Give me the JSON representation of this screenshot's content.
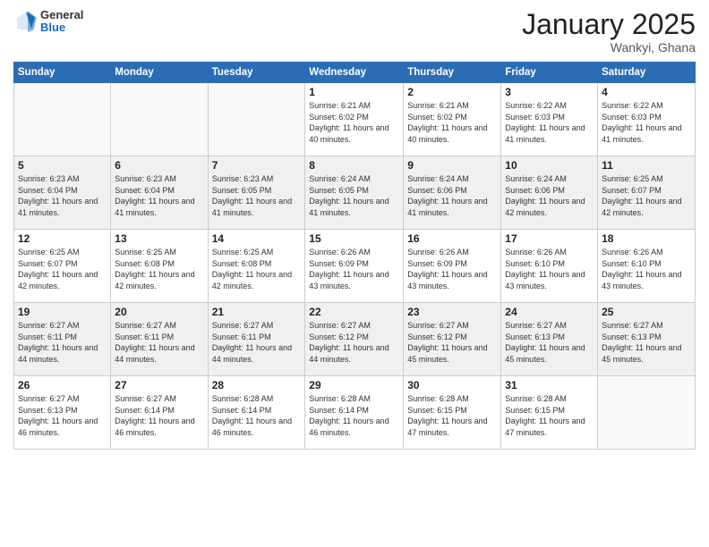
{
  "header": {
    "logo_general": "General",
    "logo_blue": "Blue",
    "month_title": "January 2025",
    "location": "Wankyi, Ghana"
  },
  "weekdays": [
    "Sunday",
    "Monday",
    "Tuesday",
    "Wednesday",
    "Thursday",
    "Friday",
    "Saturday"
  ],
  "weeks": [
    [
      {
        "day": "",
        "info": ""
      },
      {
        "day": "",
        "info": ""
      },
      {
        "day": "",
        "info": ""
      },
      {
        "day": "1",
        "info": "Sunrise: 6:21 AM\nSunset: 6:02 PM\nDaylight: 11 hours and 40 minutes."
      },
      {
        "day": "2",
        "info": "Sunrise: 6:21 AM\nSunset: 6:02 PM\nDaylight: 11 hours and 40 minutes."
      },
      {
        "day": "3",
        "info": "Sunrise: 6:22 AM\nSunset: 6:03 PM\nDaylight: 11 hours and 41 minutes."
      },
      {
        "day": "4",
        "info": "Sunrise: 6:22 AM\nSunset: 6:03 PM\nDaylight: 11 hours and 41 minutes."
      }
    ],
    [
      {
        "day": "5",
        "info": "Sunrise: 6:23 AM\nSunset: 6:04 PM\nDaylight: 11 hours and 41 minutes."
      },
      {
        "day": "6",
        "info": "Sunrise: 6:23 AM\nSunset: 6:04 PM\nDaylight: 11 hours and 41 minutes."
      },
      {
        "day": "7",
        "info": "Sunrise: 6:23 AM\nSunset: 6:05 PM\nDaylight: 11 hours and 41 minutes."
      },
      {
        "day": "8",
        "info": "Sunrise: 6:24 AM\nSunset: 6:05 PM\nDaylight: 11 hours and 41 minutes."
      },
      {
        "day": "9",
        "info": "Sunrise: 6:24 AM\nSunset: 6:06 PM\nDaylight: 11 hours and 41 minutes."
      },
      {
        "day": "10",
        "info": "Sunrise: 6:24 AM\nSunset: 6:06 PM\nDaylight: 11 hours and 42 minutes."
      },
      {
        "day": "11",
        "info": "Sunrise: 6:25 AM\nSunset: 6:07 PM\nDaylight: 11 hours and 42 minutes."
      }
    ],
    [
      {
        "day": "12",
        "info": "Sunrise: 6:25 AM\nSunset: 6:07 PM\nDaylight: 11 hours and 42 minutes."
      },
      {
        "day": "13",
        "info": "Sunrise: 6:25 AM\nSunset: 6:08 PM\nDaylight: 11 hours and 42 minutes."
      },
      {
        "day": "14",
        "info": "Sunrise: 6:25 AM\nSunset: 6:08 PM\nDaylight: 11 hours and 42 minutes."
      },
      {
        "day": "15",
        "info": "Sunrise: 6:26 AM\nSunset: 6:09 PM\nDaylight: 11 hours and 43 minutes."
      },
      {
        "day": "16",
        "info": "Sunrise: 6:26 AM\nSunset: 6:09 PM\nDaylight: 11 hours and 43 minutes."
      },
      {
        "day": "17",
        "info": "Sunrise: 6:26 AM\nSunset: 6:10 PM\nDaylight: 11 hours and 43 minutes."
      },
      {
        "day": "18",
        "info": "Sunrise: 6:26 AM\nSunset: 6:10 PM\nDaylight: 11 hours and 43 minutes."
      }
    ],
    [
      {
        "day": "19",
        "info": "Sunrise: 6:27 AM\nSunset: 6:11 PM\nDaylight: 11 hours and 44 minutes."
      },
      {
        "day": "20",
        "info": "Sunrise: 6:27 AM\nSunset: 6:11 PM\nDaylight: 11 hours and 44 minutes."
      },
      {
        "day": "21",
        "info": "Sunrise: 6:27 AM\nSunset: 6:11 PM\nDaylight: 11 hours and 44 minutes."
      },
      {
        "day": "22",
        "info": "Sunrise: 6:27 AM\nSunset: 6:12 PM\nDaylight: 11 hours and 44 minutes."
      },
      {
        "day": "23",
        "info": "Sunrise: 6:27 AM\nSunset: 6:12 PM\nDaylight: 11 hours and 45 minutes."
      },
      {
        "day": "24",
        "info": "Sunrise: 6:27 AM\nSunset: 6:13 PM\nDaylight: 11 hours and 45 minutes."
      },
      {
        "day": "25",
        "info": "Sunrise: 6:27 AM\nSunset: 6:13 PM\nDaylight: 11 hours and 45 minutes."
      }
    ],
    [
      {
        "day": "26",
        "info": "Sunrise: 6:27 AM\nSunset: 6:13 PM\nDaylight: 11 hours and 46 minutes."
      },
      {
        "day": "27",
        "info": "Sunrise: 6:27 AM\nSunset: 6:14 PM\nDaylight: 11 hours and 46 minutes."
      },
      {
        "day": "28",
        "info": "Sunrise: 6:28 AM\nSunset: 6:14 PM\nDaylight: 11 hours and 46 minutes."
      },
      {
        "day": "29",
        "info": "Sunrise: 6:28 AM\nSunset: 6:14 PM\nDaylight: 11 hours and 46 minutes."
      },
      {
        "day": "30",
        "info": "Sunrise: 6:28 AM\nSunset: 6:15 PM\nDaylight: 11 hours and 47 minutes."
      },
      {
        "day": "31",
        "info": "Sunrise: 6:28 AM\nSunset: 6:15 PM\nDaylight: 11 hours and 47 minutes."
      },
      {
        "day": "",
        "info": ""
      }
    ]
  ]
}
